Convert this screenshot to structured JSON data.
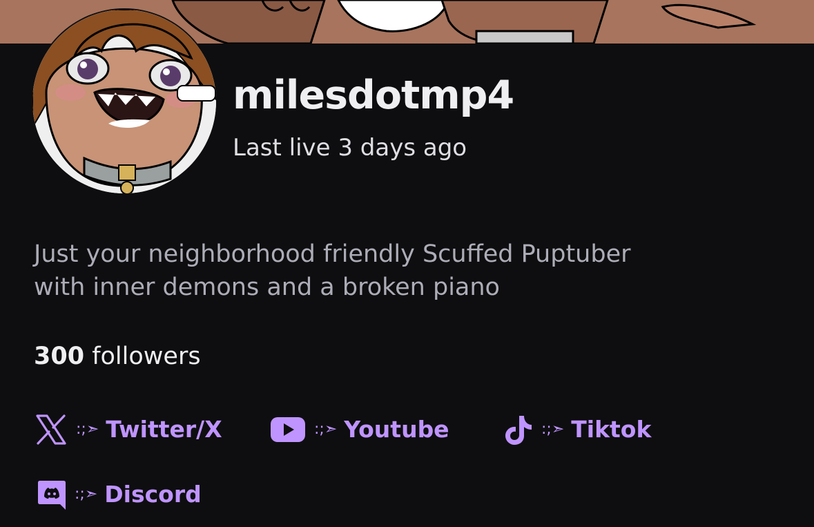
{
  "channel": {
    "name": "milesdotmp4",
    "last_live": "Last live 3 days ago",
    "bio_line1": "Just your neighborhood friendly Scuffed Puptuber",
    "bio_line2": "with inner demons and a broken piano",
    "followers_count": "300",
    "followers_label": " followers"
  },
  "social_links": [
    {
      "icon": "x-twitter-icon",
      "arrow": ":;➣",
      "label": "Twitter/X"
    },
    {
      "icon": "youtube-icon",
      "arrow": ":;➣",
      "label": "Youtube"
    },
    {
      "icon": "tiktok-icon",
      "arrow": ":;➣",
      "label": "Tiktok"
    },
    {
      "icon": "discord-icon",
      "arrow": ":;➣",
      "label": "Discord"
    }
  ],
  "colors": {
    "background": "#0e0e10",
    "accent": "#bf94ff",
    "text_primary": "#efeff1",
    "text_secondary": "#adadb8"
  }
}
